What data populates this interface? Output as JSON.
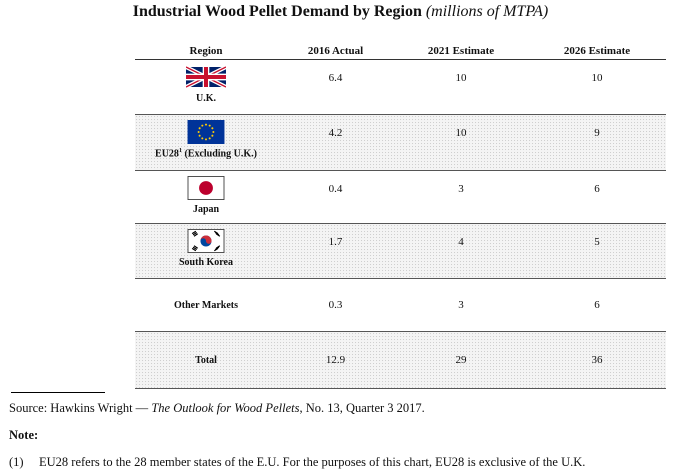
{
  "title": {
    "main": "Industrial Wood Pellet Demand by Region",
    "unit": "(millions of MTPA)"
  },
  "table": {
    "headers": [
      "Region",
      "2016 Actual",
      "2021 Estimate",
      "2026 Estimate"
    ],
    "rows": [
      {
        "region": "U.K.",
        "flag": "uk-flag-icon",
        "v2016": "6.4",
        "v2021": "10",
        "v2026": "10"
      },
      {
        "region": "EU28",
        "sup": "1",
        "region_suffix": " (Excluding U.K.)",
        "flag": "eu-flag-icon",
        "v2016": "4.2",
        "v2021": "10",
        "v2026": "9"
      },
      {
        "region": "Japan",
        "flag": "japan-flag-icon",
        "v2016": "0.4",
        "v2021": "3",
        "v2026": "6"
      },
      {
        "region": "South Korea",
        "flag": "south-korea-flag-icon",
        "v2016": "1.7",
        "v2021": "4",
        "v2026": "5"
      },
      {
        "region": "Other Markets",
        "v2016": "0.3",
        "v2021": "3",
        "v2026": "6"
      },
      {
        "region": "Total",
        "v2016": "12.9",
        "v2021": "29",
        "v2026": "36"
      }
    ]
  },
  "source": {
    "prefix": "Source: Hawkins Wright —",
    "publication": "The Outlook for Wood Pellets",
    "suffix": ", No. 13, Quarter 3 2017."
  },
  "note": {
    "heading": "Note:",
    "num": "(1)",
    "text": "EU28 refers to the 28 member states of the E.U. For the purposes of this chart, EU28 is exclusive of the U.K."
  },
  "colors": {
    "shade": "#f4f4f4",
    "uk_blue": "#012169",
    "uk_red": "#C8102E",
    "eu_blue": "#003399",
    "eu_gold": "#FFCC00",
    "jp_red": "#BC002D",
    "kr_red": "#CD2E3A",
    "kr_blue": "#0047A0"
  }
}
